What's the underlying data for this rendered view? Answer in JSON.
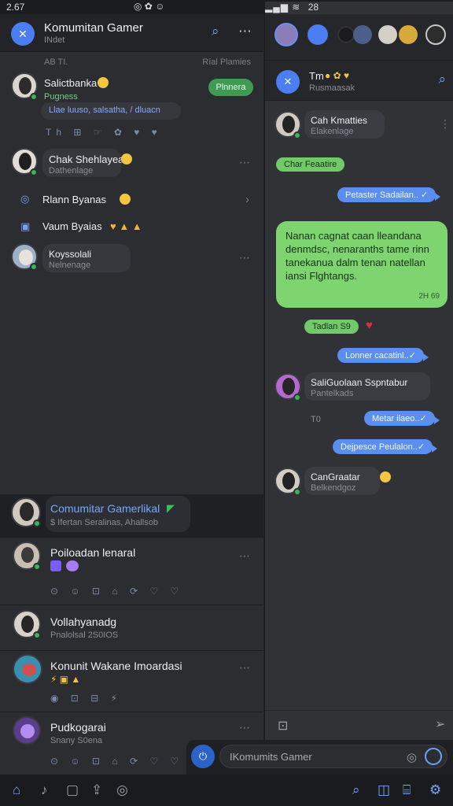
{
  "status": {
    "time": "2.67",
    "center": "◎ ✿ ☺",
    "battery": "28",
    "signal": "▂▄▆ ≋"
  },
  "left_header": {
    "title": "Komumitan Gamer",
    "subtitle": "INdet",
    "search_icon": "search-icon",
    "more_icon": "more-icon"
  },
  "subbar": {
    "left": "AB TI.",
    "right": "Ríal Plamies"
  },
  "chats": [
    {
      "name": "Salictbanka",
      "sub": "Pugness",
      "link": "Llae luuso, salsatha, / dluacn",
      "pill": "Plnnera",
      "reactions": "Th ⊞ ☞ ✿ ♥ ♥"
    },
    {
      "name": "Chak Shehlayea",
      "sub": "Dathenlage"
    },
    {
      "name": "Rlann Byanas",
      "sub": ""
    },
    {
      "name": "Vaum Byaias",
      "sub": ""
    },
    {
      "name": "Koyssolali",
      "sub": "Nelnenage"
    }
  ],
  "featured": {
    "name": "Comumitar Gamerlikal",
    "sub": "$ Ifertan Seralinas, Ahallsob"
  },
  "posts": [
    {
      "name": "Poiloadan lenaral",
      "reactions": "⊙ ☺ ⊡ ⌂ ⟳ ♡ ♡"
    },
    {
      "name": "Vollahyanadg",
      "sub": "Pnalolsal 2S0IOS"
    },
    {
      "name": "Konunit Wakane Imoardasi",
      "reactions": "◉ ⊡ ⊟ ⚡"
    },
    {
      "name": "Pudkogarai",
      "sub": "Snany S0ena",
      "reactions": "⊙ ☺ ⊡ ⌂ ⟳ ♡ ♡"
    }
  ],
  "right_header": {
    "title": "Tm",
    "subtitle": "Rusmaasak"
  },
  "messages": {
    "card1_name": "Cah Kmatties",
    "card1_sub": "Elakenlage",
    "green1": "Char Feaatire",
    "out1": "Petaster Sadailan.. ✓",
    "big": "Nanan cagnat caan lleandana denmdsc, nenaranths tame rinn tanekanua dalm tenan natellan iansi Flghtangs.",
    "big_time": "2H 69",
    "green2": "Tadlan S9",
    "out2": "Lonner cacatinl..✓",
    "card2_name": "SaliGuolaan Sspntabur",
    "card2_sub": "Pantelkads",
    "label_to": "T0",
    "out3": "Metar ilaeo..✓",
    "out4": "Dejpesce Peulalon..✓",
    "card3_name": "CanGraatar",
    "card3_sub": "Belkendgoz"
  },
  "composer": {
    "placeholder": "IKomumits Gamer"
  },
  "colors": {
    "accent": "#4c7ef3",
    "green": "#71c96a",
    "bubble_out": "#5a8ff0"
  }
}
